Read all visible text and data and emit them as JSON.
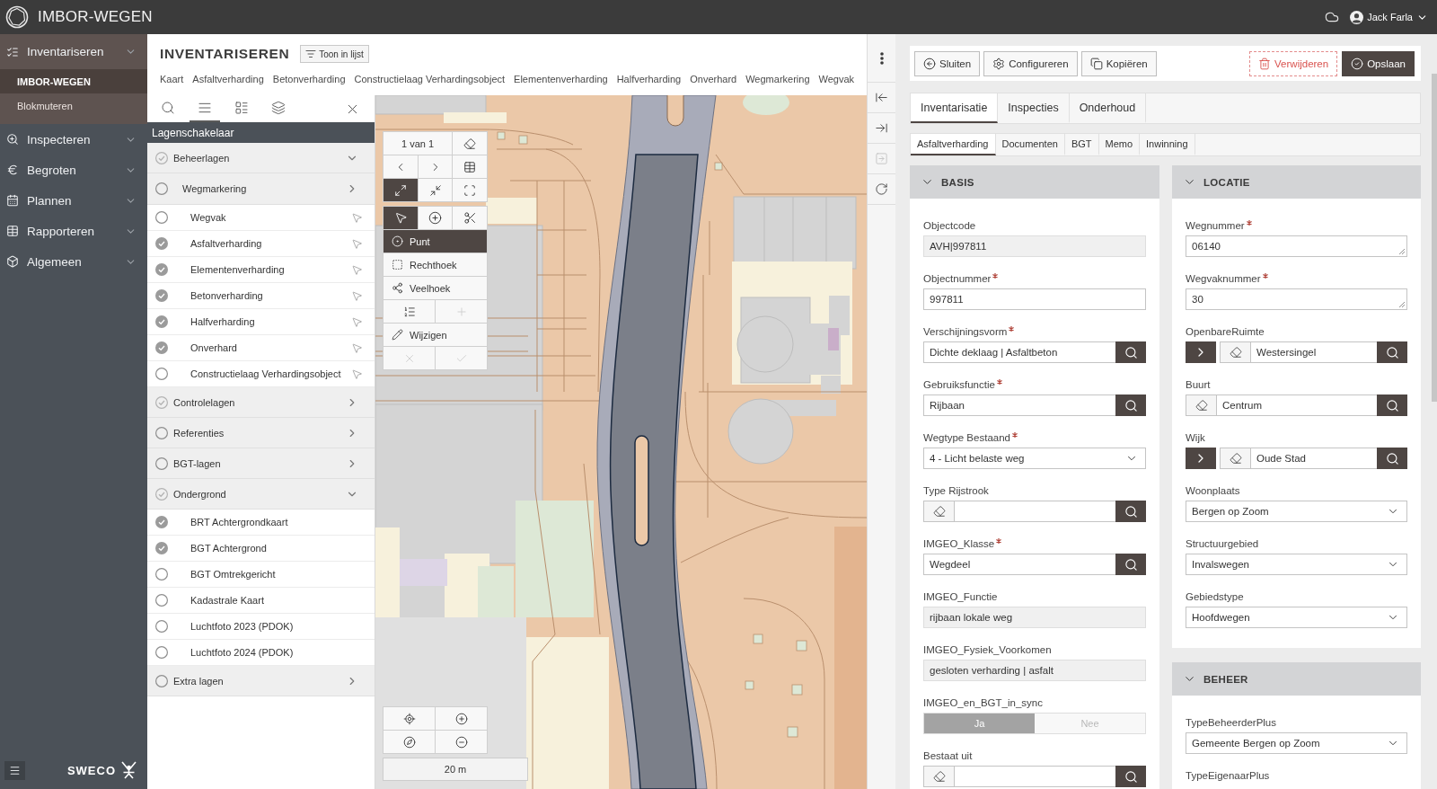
{
  "header": {
    "app_title": "IMBOR-WEGEN",
    "user": "Jack Farla"
  },
  "nav": {
    "items": [
      {
        "label": "Inventariseren",
        "expanded": true,
        "children": [
          {
            "label": "IMBOR-WEGEN",
            "selected": true
          },
          {
            "label": "Blokmuteren",
            "selected": false
          }
        ]
      },
      {
        "label": "Inspecteren",
        "expanded": false
      },
      {
        "label": "Begroten",
        "expanded": false
      },
      {
        "label": "Plannen",
        "expanded": false
      },
      {
        "label": "Rapporteren",
        "expanded": false
      },
      {
        "label": "Algemeen",
        "expanded": false
      }
    ],
    "brand": "SWECO"
  },
  "page": {
    "title": "INVENTARISEREN",
    "list_button": "Toon in lijst",
    "tabs": [
      "Kaart",
      "Asfaltverharding",
      "Betonverharding",
      "Constructielaag Verhardingsobject",
      "Elementenverharding",
      "Halfverharding",
      "Onverhard",
      "Wegmarkering",
      "Wegvak"
    ]
  },
  "layer_panel": {
    "tools": [
      {
        "selected": false
      },
      {
        "selected": true
      },
      {
        "selected": false
      },
      {
        "selected": false
      }
    ],
    "title": "Lagenschakelaar",
    "layers": [
      {
        "kind": "group",
        "label": "Beheerlagen",
        "partially_checked": true,
        "expanded": true,
        "children": [
          {
            "kind": "group",
            "label": "Wegmarkering",
            "partially_checked": false,
            "expanded": false
          },
          {
            "kind": "layer",
            "label": "Wegvak",
            "checked": false,
            "selectable": true
          },
          {
            "kind": "layer",
            "label": "Asfaltverharding",
            "checked": true,
            "selectable": true
          },
          {
            "kind": "layer",
            "label": "Elementenverharding",
            "checked": true,
            "selectable": true
          },
          {
            "kind": "layer",
            "label": "Betonverharding",
            "checked": true,
            "selectable": true
          },
          {
            "kind": "layer",
            "label": "Halfverharding",
            "checked": true,
            "selectable": true
          },
          {
            "kind": "layer",
            "label": "Onverhard",
            "checked": true,
            "selectable": true
          },
          {
            "kind": "layer",
            "label": "Constructielaag Verhardingsobject",
            "checked": false,
            "selectable": true
          }
        ]
      },
      {
        "kind": "group",
        "label": "Controlelagen",
        "partially_checked": true,
        "expanded": false
      },
      {
        "kind": "group",
        "label": "Referenties",
        "partially_checked": false,
        "expanded": false
      },
      {
        "kind": "group",
        "label": "BGT-lagen",
        "partially_checked": false,
        "expanded": false
      },
      {
        "kind": "group",
        "label": "Ondergrond",
        "partially_checked": true,
        "expanded": true,
        "children": [
          {
            "kind": "layer",
            "label": "BRT Achtergrondkaart",
            "checked": true,
            "selectable": false
          },
          {
            "kind": "layer",
            "label": "BGT Achtergrond",
            "checked": true,
            "selectable": false
          },
          {
            "kind": "layer",
            "label": "BGT Omtrekgericht",
            "checked": false,
            "selectable": false
          },
          {
            "kind": "layer",
            "label": "Kadastrale Kaart",
            "checked": false,
            "selectable": false
          },
          {
            "kind": "layer",
            "label": "Luchtfoto 2023 (PDOK)",
            "checked": false,
            "selectable": false
          },
          {
            "kind": "layer",
            "label": "Luchtfoto 2024 (PDOK)",
            "checked": false,
            "selectable": false
          }
        ]
      },
      {
        "kind": "group",
        "label": "Extra lagen",
        "partially_checked": false,
        "expanded": false
      }
    ]
  },
  "map_tools": {
    "counter": "1 van 1",
    "view_buttons": [
      {
        "selected": true
      },
      {
        "selected": false
      },
      {
        "selected": false
      }
    ],
    "select_buttons": [
      {
        "selected": true
      },
      {
        "selected": false
      },
      {
        "selected": false
      }
    ],
    "draw_modes": [
      {
        "label": "Punt",
        "selected": true
      },
      {
        "label": "Rechthoek",
        "selected": false
      },
      {
        "label": "Veelhoek",
        "selected": false
      }
    ],
    "list_buttons": [
      {
        "disabled": false
      },
      {
        "disabled": true
      }
    ],
    "edit_label": "Wijzigen",
    "confirm_buttons": [
      {
        "disabled": true
      },
      {
        "disabled": true
      }
    ],
    "scale": "20 m"
  },
  "side_strip": [
    {
      "disabled": false
    },
    {
      "disabled": false
    },
    {
      "disabled": true
    },
    {
      "disabled": false
    }
  ],
  "record": {
    "actions": [
      {
        "label": "Sluiten",
        "kind": "close"
      },
      {
        "label": "Configureren",
        "kind": "configure"
      },
      {
        "label": "Kopiëren",
        "kind": "copy"
      },
      {
        "label": "Verwijderen",
        "kind": "delete"
      },
      {
        "label": "Opslaan",
        "kind": "save"
      }
    ],
    "tabs": [
      {
        "label": "Inventarisatie",
        "selected": true
      },
      {
        "label": "Inspecties",
        "selected": false
      },
      {
        "label": "Onderhoud",
        "selected": false
      }
    ],
    "subtabs": [
      {
        "label": "Asfaltverharding",
        "selected": true
      },
      {
        "label": "Documenten",
        "selected": false
      },
      {
        "label": "BGT",
        "selected": false
      },
      {
        "label": "Memo",
        "selected": false
      },
      {
        "label": "Inwinning",
        "selected": false
      }
    ],
    "columns": [
      {
        "sections": [
          {
            "title": "BASIS",
            "expanded": true,
            "fields": [
              {
                "kind": "readonly",
                "label": "Objectcode",
                "required": false,
                "value": "AVH|997811"
              },
              {
                "kind": "text",
                "label": "Objectnummer",
                "required": true,
                "value": "997811"
              },
              {
                "kind": "lookup",
                "label": "Verschijningsvorm",
                "required": true,
                "value": "Dichte deklaag | Asfaltbeton",
                "drilldown": false,
                "clearable": false
              },
              {
                "kind": "lookup",
                "label": "Gebruiksfunctie",
                "required": true,
                "value": "Rijbaan",
                "drilldown": false,
                "clearable": false
              },
              {
                "kind": "select",
                "label": "Wegtype Bestaand",
                "required": true,
                "value": "4 - Licht belaste weg"
              },
              {
                "kind": "lookup",
                "label": "Type Rijstrook",
                "required": false,
                "drilldown": false,
                "clearable": true
              },
              {
                "kind": "lookup",
                "label": "IMGEO_Klasse",
                "required": true,
                "value": "Wegdeel",
                "drilldown": false,
                "clearable": false
              },
              {
                "kind": "readonly",
                "label": "IMGEO_Functie",
                "required": false,
                "value": "rijbaan lokale weg"
              },
              {
                "kind": "readonly",
                "label": "IMGEO_Fysiek_Voorkomen",
                "required": false,
                "value": "gesloten verharding | asfalt"
              },
              {
                "kind": "toggle",
                "label": "IMGEO_en_BGT_in_sync",
                "required": false,
                "options": [
                  {
                    "label": "Ja",
                    "selected": true
                  },
                  {
                    "label": "Nee",
                    "selected": false
                  }
                ]
              },
              {
                "kind": "lookup",
                "label": "Bestaat uit",
                "required": false,
                "drilldown": false,
                "clearable": true
              }
            ]
          }
        ]
      },
      {
        "sections": [
          {
            "title": "LOCATIE",
            "expanded": true,
            "fields": [
              {
                "kind": "textarea",
                "label": "Wegnummer",
                "required": true,
                "value": "06140"
              },
              {
                "kind": "textarea",
                "label": "Wegvaknummer",
                "required": true,
                "value": "30"
              },
              {
                "kind": "lookup",
                "label": "OpenbareRuimte",
                "required": false,
                "value": "Westersingel",
                "drilldown": true,
                "clearable": true
              },
              {
                "kind": "lookup",
                "label": "Buurt",
                "required": false,
                "value": "Centrum",
                "drilldown": false,
                "clearable": true
              },
              {
                "kind": "lookup",
                "label": "Wijk",
                "required": false,
                "value": "Oude Stad",
                "drilldown": true,
                "clearable": true
              },
              {
                "kind": "select",
                "label": "Woonplaats",
                "required": false,
                "value": "Bergen op Zoom"
              },
              {
                "kind": "select",
                "label": "Structuurgebied",
                "required": false,
                "value": "Invalswegen"
              },
              {
                "kind": "select",
                "label": "Gebiedstype",
                "required": false,
                "value": "Hoofdwegen"
              }
            ]
          },
          {
            "title": "BEHEER",
            "expanded": true,
            "fields": [
              {
                "kind": "select",
                "label": "TypeBeheerderPlus",
                "required": false,
                "value": "Gemeente Bergen op Zoom"
              },
              {
                "kind": "label_only",
                "label": "TypeEigenaarPlus",
                "required": false
              }
            ]
          }
        ]
      }
    ]
  }
}
